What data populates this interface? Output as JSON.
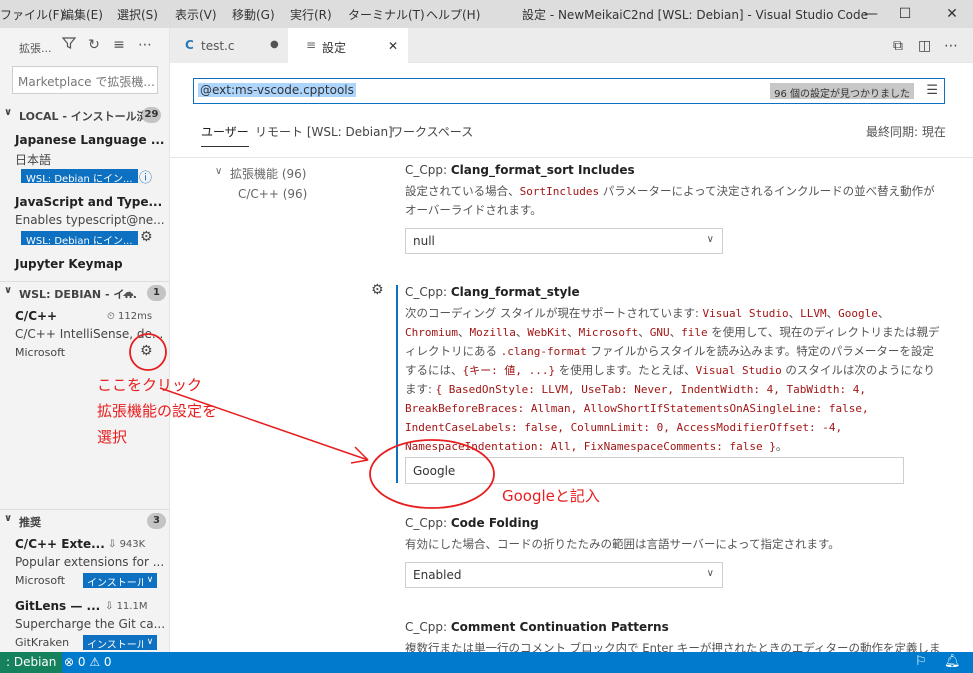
{
  "menubar": {
    "items": [
      "ファイル(F)",
      "編集(E)",
      "選択(S)",
      "表示(V)",
      "移動(G)",
      "実行(R)",
      "ターミナル(T)",
      "ヘルプ(H)"
    ],
    "window_title": "設定 - NewMeikaiC2nd [WSL: Debian] - Visual Studio Code"
  },
  "sidebar": {
    "title": "拡張...",
    "search_placeholder": "Marketplace で拡張機...",
    "local": {
      "header": "LOCAL - インストール済み",
      "count": "29",
      "items": [
        {
          "name": "Japanese Language ...",
          "desc": "日本語",
          "tag": "WSL: Debian にイン..."
        },
        {
          "name": "JavaScript and Type...",
          "desc": "Enables typescript@ne...",
          "tag": "WSL: Debian にイン..."
        },
        {
          "name": "Jupyter Keymap",
          "desc": "",
          "tag": ""
        }
      ]
    },
    "wsl": {
      "header": "WSL: DEBIAN - イ...",
      "count": "1",
      "items": [
        {
          "name": "C/C++",
          "time": "112ms",
          "desc": "C/C++ IntelliSense, de...",
          "publisher": "Microsoft"
        }
      ]
    },
    "recommended": {
      "header": "推奨",
      "count": "3",
      "items": [
        {
          "name": "C/C++ Exte...",
          "downloads": "943K",
          "desc": "Popular extensions for ...",
          "publisher": "Microsoft",
          "install": "インストール"
        },
        {
          "name": "GitLens — ...",
          "downloads": "11.1M",
          "desc": "Supercharge the Git ca...",
          "publisher": "GitKraken",
          "install": "インストール"
        }
      ]
    }
  },
  "tabs": [
    {
      "icon": "C",
      "label": "test.c",
      "modified": "●"
    },
    {
      "icon": "≡",
      "label": "設定",
      "close": "✕"
    }
  ],
  "settings": {
    "search_value": "@ext:ms-vscode.cpptools",
    "found": "96 個の設定が見つかりました",
    "scopes": [
      "ユーザー",
      "リモート [WSL: Debian]",
      "ワークスペース"
    ],
    "last_sync": "最終同期: 現在",
    "toc": {
      "group": "拡張機能 (96)",
      "child": "C/C++ (96)"
    },
    "items": [
      {
        "prefix": "C_Cpp: ",
        "name": "Clang_format_sort Includes",
        "desc_parts": [
          "設定されている場合、",
          "SortIncludes",
          " パラメーターによって決定されるインクルードの並べ替え動作がオーバーライドされます。"
        ],
        "value": "null"
      },
      {
        "prefix": "C_Cpp: ",
        "name": "Clang_format_style",
        "desc": {
          "p1": "次のコーディング スタイルが現在サポートされています: ",
          "c1": "Visual Studio",
          "c2": "LLVM",
          "c3": "Google",
          "c4": "Chromium",
          "c5": "Mozilla",
          "c6": "WebKit",
          "c7": "Microsoft",
          "c8": "GNU",
          "sep": "、",
          "p2": "、",
          "c9": "file",
          "p3": " を使用して、現在のディレクトリまたは親ディレクトリにある ",
          "c10": ".clang-format",
          "p4": " ファイルからスタイルを読み込みます。特定のパラメーターを設定するには、",
          "c11": "{キー: 値, ...}",
          "p5": " を使用します。たとえば、",
          "c12": "Visual Studio",
          "p6": " のスタイルは次のようになります: ",
          "c13": "{ BasedOnStyle: LLVM, UseTab: Never, IndentWidth: 4, TabWidth: 4, BreakBeforeBraces: Allman, AllowShortIfStatementsOnASingleLine: false, IndentCaseLabels: false, ColumnLimit: 0, AccessModifierOffset: -4, NamespaceIndentation: All, FixNamespaceComments: false }",
          "p7": "。"
        },
        "value": "Google"
      },
      {
        "prefix": "C_Cpp: ",
        "name": "Code Folding",
        "desc": "有効にした場合、コードの折りたたみの範囲は言語サーバーによって指定されます。",
        "value": "Enabled"
      },
      {
        "prefix": "C_Cpp: ",
        "name": "Comment Continuation Patterns",
        "desc": "複数行または単一行のコメント ブロック内で Enter キーが押されたときのエディターの動作を定義します。"
      }
    ]
  },
  "statusbar": {
    "remote": ": Debian",
    "problems": "⊗ 0 ⚠ 0"
  },
  "annotations": {
    "a1": "ここをクリック",
    "a2": "拡張機能の設定を",
    "a3": "選択",
    "b1": "Googleと記入",
    "color": "#e81e1e"
  },
  "colors": {
    "accent": "#0e70c0",
    "status": "#007acc",
    "remote": "#16825d"
  }
}
